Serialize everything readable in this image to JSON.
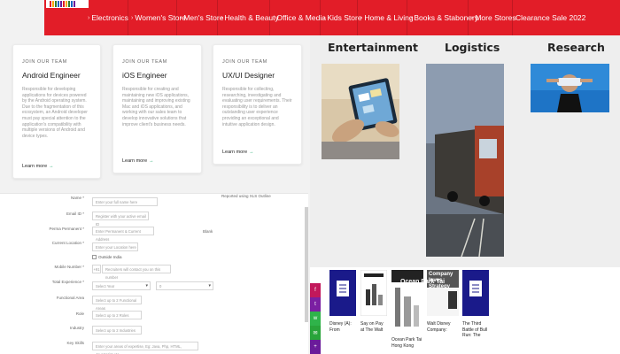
{
  "nav": {
    "items": [
      "Electronics",
      "Women's Store",
      "Men's Store",
      "Health & Beauty",
      "Office & Media",
      "Kids Store",
      "Home & Living",
      "Books & Stabonery",
      "More Stores",
      "Clearance Sale 2022"
    ],
    "accent": "#e21d28"
  },
  "cards": [
    {
      "eyebrow": "JOIN OUR TEAM",
      "role": "Android Engineer",
      "desc": "Responsible for developing applications for devices powered by the Android operating system. Due to the fragmentation of this ecosystem, an Android developer must pay special attention to the application's compatibility with multiple versions of Android and device types.",
      "more": "Learn more"
    },
    {
      "eyebrow": "JOIN OUR TEAM",
      "role": "iOS Engineer",
      "desc": "Responsible for creating and maintaining new iOS applications, maintaining and improving existing Mac and iOS applications, and working with our sales team to develop innovative solutions that improve client's business needs.",
      "more": "Learn more"
    },
    {
      "eyebrow": "JOIN OUR TEAM",
      "role": "UX/UI Designer",
      "desc": "Responsible for collecting, researching, investigating and evaluating user requirements. Their responsibility is to deliver an outstanding user experience providing an exceptional and intuitive application design.",
      "more": "Learn more"
    }
  ],
  "sections": {
    "entertainment": "Entertainment",
    "logistics": "Logistics",
    "research": "Research"
  },
  "form": {
    "name_label": "Name *",
    "name_placeholder": "Enter your full name here",
    "email_label": "Email ID *",
    "email_placeholder": "Register with your active email ID",
    "email_note": "Reported using XLS Outline",
    "perm_label": "Perma Permanent *",
    "perm_placeholder": "Enter Permanent & Current Address",
    "perm_note": "Blank",
    "loc_label": "Current Location *",
    "loc_placeholder": "Enter your Location here",
    "outside_label": "Outside India",
    "mobile_label": "Mobile Number *",
    "mobile_code": "+91",
    "mobile_placeholder": "Recruiters will contact you on this number",
    "exp_label": "Total Experience *",
    "exp_years": "Select Year",
    "exp_months": "0",
    "func_label": "Functional Area",
    "func_placeholder": "Select up to 2 Functional Areas",
    "role_label": "Role",
    "role_placeholder": "Select up to 2 Roles",
    "industry_label": "Industry",
    "industry_placeholder": "Select up to 2 Industries",
    "skills_label": "Key Skills",
    "skills_placeholder": "Enter your areas of expertise, Eg: Java, Php, HTML, JavaScript etc"
  },
  "share": [
    {
      "name": "facebook",
      "glyph": "f",
      "color": "#c2185b"
    },
    {
      "name": "twitter",
      "glyph": "t",
      "color": "#7b1fa2"
    },
    {
      "name": "whatsapp",
      "glyph": "w",
      "color": "#2fb34a"
    },
    {
      "name": "email",
      "glyph": "✉",
      "color": "#29a43a"
    },
    {
      "name": "more",
      "glyph": "+",
      "color": "#6a1b9a"
    }
  ],
  "books": [
    {
      "title": "Disney (A): From",
      "color": "#1a1a8a"
    },
    {
      "title": "Say on Pay at The Walt",
      "color": "#ffffff"
    },
    {
      "title": "Ocean Park Tai Hong Kong",
      "color": "#333333"
    },
    {
      "title": "Walt Disney Company:",
      "color": "#555555"
    },
    {
      "title": "The Third Battle of Bull Run: The",
      "color": "#1a1a8a"
    }
  ],
  "book_cover_texts": [
    "",
    "",
    "Ocean Park Tai",
    "Company Inves Strategy",
    ""
  ]
}
